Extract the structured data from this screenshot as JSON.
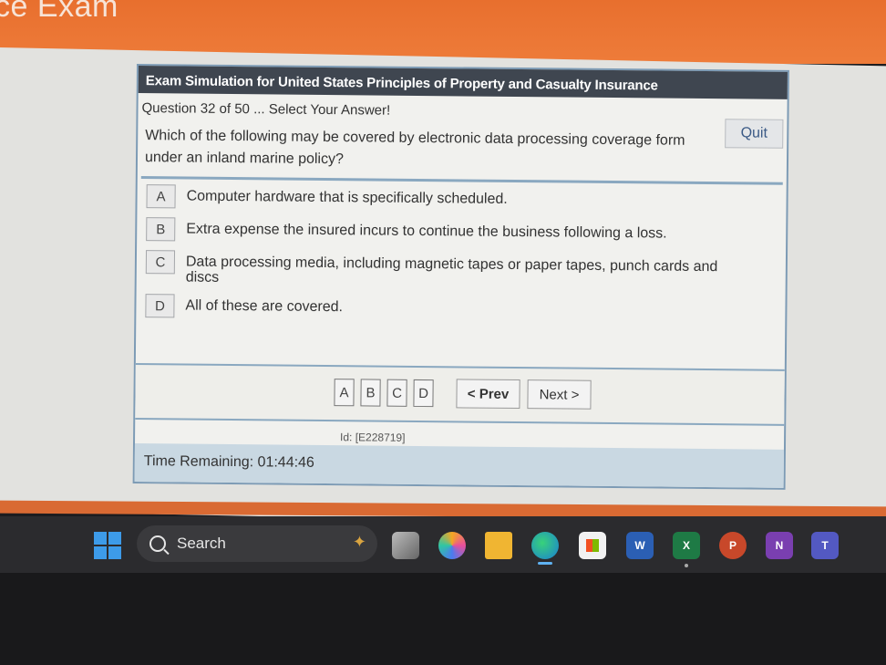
{
  "page": {
    "heading": "ice Exam"
  },
  "exam": {
    "title": "Exam Simulation for United States Principles of Property and Casualty Insurance",
    "question_meta": "Question 32 of 50 ... Select Your Answer!",
    "quit_label": "Quit",
    "question_text": "Which of the following may be covered by electronic data processing coverage form under an inland marine policy?",
    "answers": [
      {
        "letter": "A",
        "text": "Computer hardware that is specifically scheduled."
      },
      {
        "letter": "B",
        "text": "Extra expense the insured incurs to continue the business following a loss."
      },
      {
        "letter": "C",
        "text": "Data processing media, including magnetic tapes or paper tapes, punch cards and discs"
      },
      {
        "letter": "D",
        "text": "All of these are covered."
      }
    ],
    "nav_letters": [
      "A",
      "B",
      "C",
      "D"
    ],
    "prev_label": "< Prev",
    "next_label": "Next >",
    "question_id": "Id: [E228719]",
    "time_remaining": "Time Remaining: 01:44:46"
  },
  "taskbar": {
    "search_label": "Search",
    "word_glyph": "W",
    "excel_glyph": "X",
    "ppt_glyph": "P",
    "onenote_glyph": "N",
    "teams_glyph": "T",
    "icons": [
      "windows-start-icon",
      "search-icon",
      "task-view-icon",
      "copilot-icon",
      "file-explorer-icon",
      "edge-icon",
      "store-icon",
      "word-icon",
      "excel-icon",
      "powerpoint-icon",
      "onenote-icon",
      "teams-icon"
    ],
    "accent_color": "#3d9be9"
  }
}
